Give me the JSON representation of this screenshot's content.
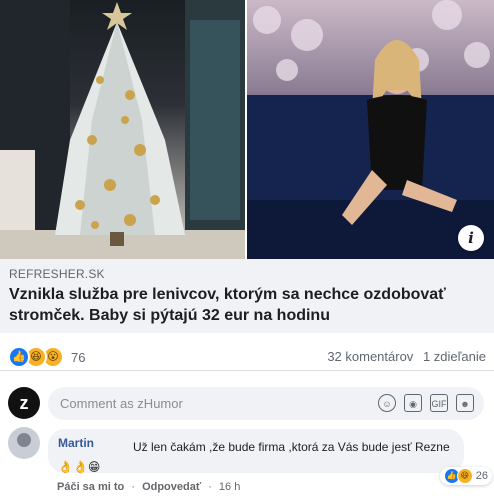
{
  "link": {
    "domain": "REFRESHER.SK",
    "title": "Vznikla služba pre lenivcov, ktorým sa nechce ozdobovať stromček. Baby si pýtajú 32 eur na hodinu"
  },
  "stats": {
    "reaction_count": "76",
    "reactions": [
      "like",
      "haha",
      "wow"
    ],
    "comments": "32 komentárov",
    "shares": "1 zdieľanie"
  },
  "composer": {
    "placeholder": "Comment as zHumor",
    "page_avatar_letter": "z",
    "icons": [
      "emoji-icon",
      "camera-icon",
      "gif-icon",
      "sticker-icon"
    ]
  },
  "comment": {
    "author": "Martin",
    "text": "Už len čakám ,že bude firma ,ktorá za Vás bude jesť Rezne 👌👌😁",
    "reaction_count": "26",
    "actions": {
      "like": "Páči sa mi to",
      "reply": "Odpovedať",
      "time": "16 h"
    }
  },
  "colors": {
    "accent": "#1877f2",
    "link_box_bg": "#f0f2f5",
    "author_link": "#385898"
  }
}
